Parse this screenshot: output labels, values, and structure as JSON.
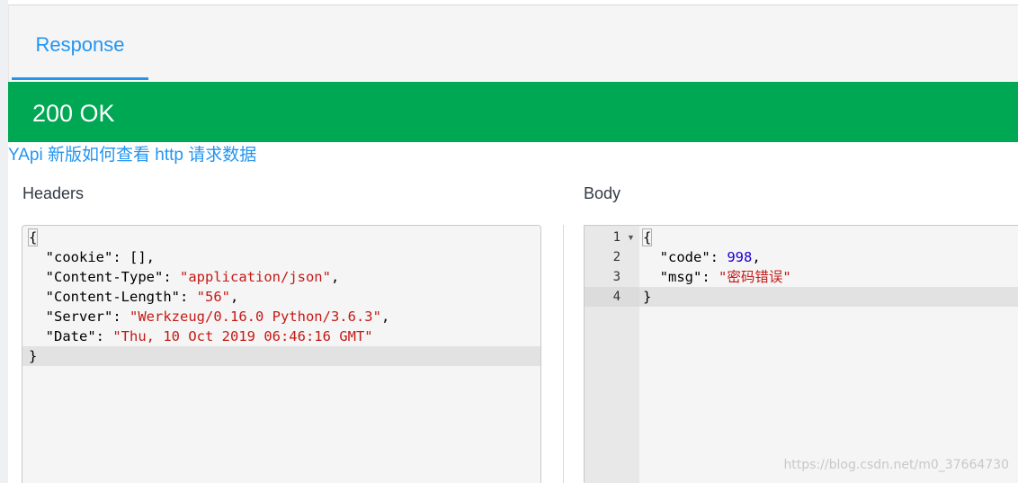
{
  "tabs": {
    "response_label": "Response"
  },
  "status": {
    "text": "200 OK",
    "color": "#00a854"
  },
  "note": {
    "text": "YApi 新版如何查看 http 请求数据"
  },
  "headers_panel": {
    "title": "Headers",
    "lines": {
      "l1": "{",
      "l2_key": "\"cookie\"",
      "l2_val": "[],",
      "l3_key": "\"Content-Type\"",
      "l3_val": "\"application/json\"",
      "l4_key": "\"Content-Length\"",
      "l4_val": "\"56\"",
      "l5_key": "\"Server\"",
      "l5_val": "\"Werkzeug/0.16.0 Python/3.6.3\"",
      "l6_key": "\"Date\"",
      "l6_val": "\"Thu, 10 Oct 2019 06:46:16 GMT\"",
      "l7": "}"
    }
  },
  "body_panel": {
    "title": "Body",
    "line_numbers": [
      "1",
      "2",
      "3",
      "4"
    ],
    "lines": {
      "l1": "{",
      "l2_key": "\"code\"",
      "l2_val": "998",
      "l3_key": "\"msg\"",
      "l3_val": "\"密码错误\"",
      "l4": "}"
    }
  },
  "watermark": {
    "text": "https://blog.csdn.net/m0_37664730"
  },
  "colors": {
    "accent": "#2395f1",
    "success": "#00a854",
    "string": "#c41a16",
    "number": "#1c00cf"
  }
}
